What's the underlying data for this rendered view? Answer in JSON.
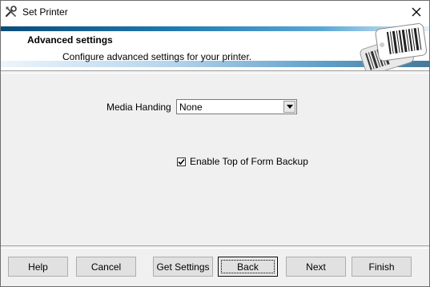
{
  "window": {
    "title": "Set Printer",
    "icon": "tools-icon",
    "close_icon": "close-icon"
  },
  "header": {
    "title": "Advanced settings",
    "subtitle": "Configure advanced settings for your printer.",
    "graphic": "barcode-labels-icon"
  },
  "form": {
    "media_label": "Media Handing",
    "media_value": "None",
    "checkbox_label": "Enable Top of Form Backup",
    "checkbox_checked": true
  },
  "buttons": {
    "help": "Help",
    "cancel": "Cancel",
    "get_settings": "Get Settings",
    "back": "Back",
    "next": "Next",
    "finish": "Finish"
  }
}
